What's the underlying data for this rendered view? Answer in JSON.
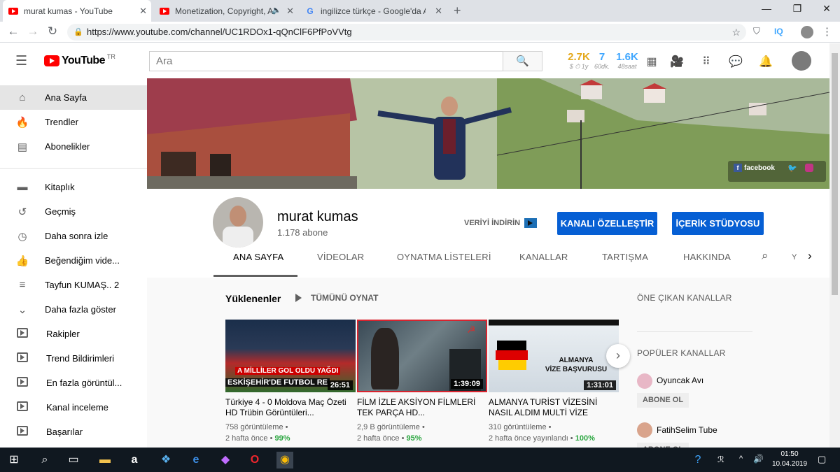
{
  "browser": {
    "tabs": [
      {
        "label": "murat kumas - YouTube",
        "icon": "youtube-favicon",
        "active": true
      },
      {
        "label": "Monetization, Copyright, Art",
        "icon": "youtube-favicon",
        "active": false
      },
      {
        "label": "ingilizce türkçe - Google'da Ara",
        "icon": "google-favicon",
        "active": false
      }
    ],
    "url": "https://www.youtube.com/channel/UC1RDOx1-qQnClF6PfPoVVtg",
    "iq_label": "IQ"
  },
  "youtube": {
    "logo_text": "YouTube",
    "country_code": "TR",
    "search_placeholder": "Ara",
    "stats": [
      {
        "value": "2.7K",
        "sub": "$ ⏱ 1y",
        "color": "#e4a81a"
      },
      {
        "value": "7",
        "sub": "60dk.",
        "color": "#3ea6ff"
      },
      {
        "value": "1.6K",
        "sub": "48saat",
        "color": "#3ea6ff"
      }
    ]
  },
  "sidebar": {
    "items": [
      {
        "label": "Ana Sayfa",
        "icon": "home-icon"
      },
      {
        "label": "Trendler",
        "icon": "fire-icon"
      },
      {
        "label": "Abonelikler",
        "icon": "subscriptions-icon"
      },
      {
        "label": "Kitaplık",
        "icon": "folder-icon"
      },
      {
        "label": "Geçmiş",
        "icon": "history-icon"
      },
      {
        "label": "Daha sonra izle",
        "icon": "clock-icon"
      },
      {
        "label": "Beğendiğim vide...",
        "icon": "thumbs-up-icon"
      },
      {
        "label": "Tayfun KUMAŞ.. 2",
        "icon": "playlist-icon"
      },
      {
        "label": "Daha fazla göster",
        "icon": "chevron-down-icon"
      },
      {
        "label": "Rakipler",
        "icon": "playlist-play-icon"
      },
      {
        "label": "Trend Bildirimleri",
        "icon": "playlist-play-icon"
      },
      {
        "label": "En fazla görüntül...",
        "icon": "playlist-play-icon"
      },
      {
        "label": "Kanal inceleme",
        "icon": "playlist-play-icon"
      },
      {
        "label": "Başarılar",
        "icon": "playlist-play-icon"
      }
    ]
  },
  "channel": {
    "banner_social": "facebook",
    "name": "murat kumas",
    "subscribers": "1.178 abone",
    "download_label": "VERİYİ İNDİRİN",
    "customize_button": "KANALI ÖZELLEŞTİR",
    "studio_button": "İÇERİK STÜDYOSU",
    "tabs": [
      "ANA SAYFA",
      "VİDEOLAR",
      "OYNATMA LİSTELERİ",
      "KANALLAR",
      "TARTIŞMA",
      "HAKKINDA"
    ],
    "tab_overflow": "Y"
  },
  "uploads": {
    "title": "Yüklenenler",
    "play_all": "TÜMÜNÜ OYNAT",
    "videos": [
      {
        "thumb_caption1": "A MİLLİLER GOL OLDU YAĞDI",
        "thumb_caption2": "ESKİŞEHİR'DE FUTBOL RE",
        "duration": "26:51",
        "title": "Türkiye 4 - 0 Moldova Maç Özeti HD Trübin Görüntüleri...",
        "views": "758 görüntüleme",
        "age": "2 hafta önce",
        "pct": "99%"
      },
      {
        "thumb_caption1": "",
        "thumb_caption2": "",
        "duration": "1:39:09",
        "title": "FİLM İZLE AKSİYON FİLMLERİ TEK PARÇA HD...",
        "views": "2,9 B görüntüleme",
        "age": "2 hafta önce",
        "pct": "95%"
      },
      {
        "thumb_caption1": "ALMANYA",
        "thumb_caption2": "VİZE BAŞVURUSU",
        "duration": "1:31:01",
        "title": "ALMANYA TURİST VİZESİNİ NASIL ALDIM MULTİ VİZE",
        "views": "310 görüntüleme",
        "age": "2 hafta önce yayınlandı",
        "pct": "100%"
      }
    ]
  },
  "right_panel": {
    "featured_title": "ÖNE ÇIKAN KANALLAR",
    "popular_title": "POPÜLER KANALLAR",
    "channels": [
      {
        "name": "Oyuncak Avı",
        "button": "ABONE OL"
      },
      {
        "name": "FatihSelim Tube",
        "button": "ABONE OL"
      }
    ]
  },
  "taskbar": {
    "time": "01:50",
    "date": "10.04.2019"
  }
}
